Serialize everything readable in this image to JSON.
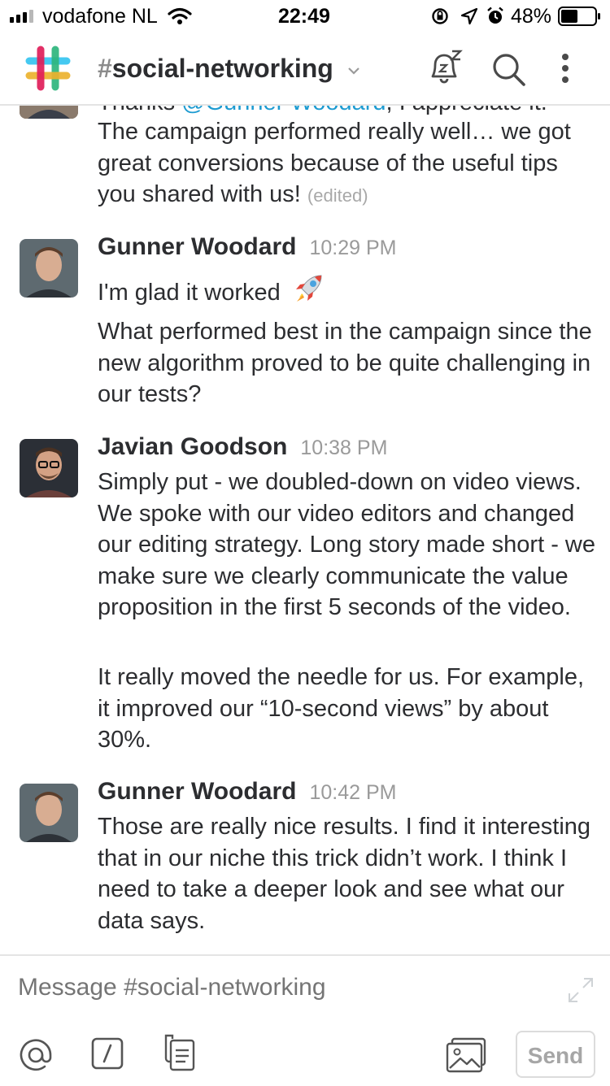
{
  "status_bar": {
    "carrier": "vodafone NL",
    "time": "22:49",
    "battery": "48%"
  },
  "header": {
    "channel_hash": "#",
    "channel_name": "social-networking"
  },
  "messages": [
    {
      "partial_line_prefix": "Thanks ",
      "partial_mention": "@Gunner Woodard",
      "partial_line_suffix": ", I appreciate it.",
      "text": "The campaign performed really well… we got great conversions because of the useful tips you shared with us!",
      "edited": "(edited)"
    },
    {
      "author": "Gunner Woodard",
      "time": "10:29 PM",
      "text1": "I'm glad it worked",
      "text2": "What performed best in the campaign since the new algorithm proved to be quite challenging in our tests?"
    },
    {
      "author": "Javian Goodson",
      "time": "10:38 PM",
      "text1": "Simply put - we doubled-down on video views. We spoke with our video editors and changed our editing strategy. Long story made short - we make sure we clearly communicate the value proposition in the first 5 seconds of the video.",
      "text2": "It really moved the needle for us. For example, it improved our “10-second views” by about 30%."
    },
    {
      "author": "Gunner Woodard",
      "time": "10:42 PM",
      "text1": "Those are really nice results. I find it interesting that in our niche this trick didn’t work. I think I need to take a deeper look and see what our data says."
    }
  ],
  "composer": {
    "placeholder": "Message #social-networking",
    "send_label": "Send"
  },
  "icons": {
    "logo": "slack-logo",
    "dnd": "snooze-bell-icon",
    "search": "search-icon",
    "more": "more-vertical-icon",
    "mention": "at-icon",
    "slash": "slash-command-icon",
    "files": "files-icon",
    "photo": "photo-icon",
    "expand": "expand-icon",
    "rocket": "rocket-emoji"
  },
  "colors": {
    "mention": "#1d9bd1",
    "text": "#2c2d30",
    "muted": "#9a9a9a"
  }
}
